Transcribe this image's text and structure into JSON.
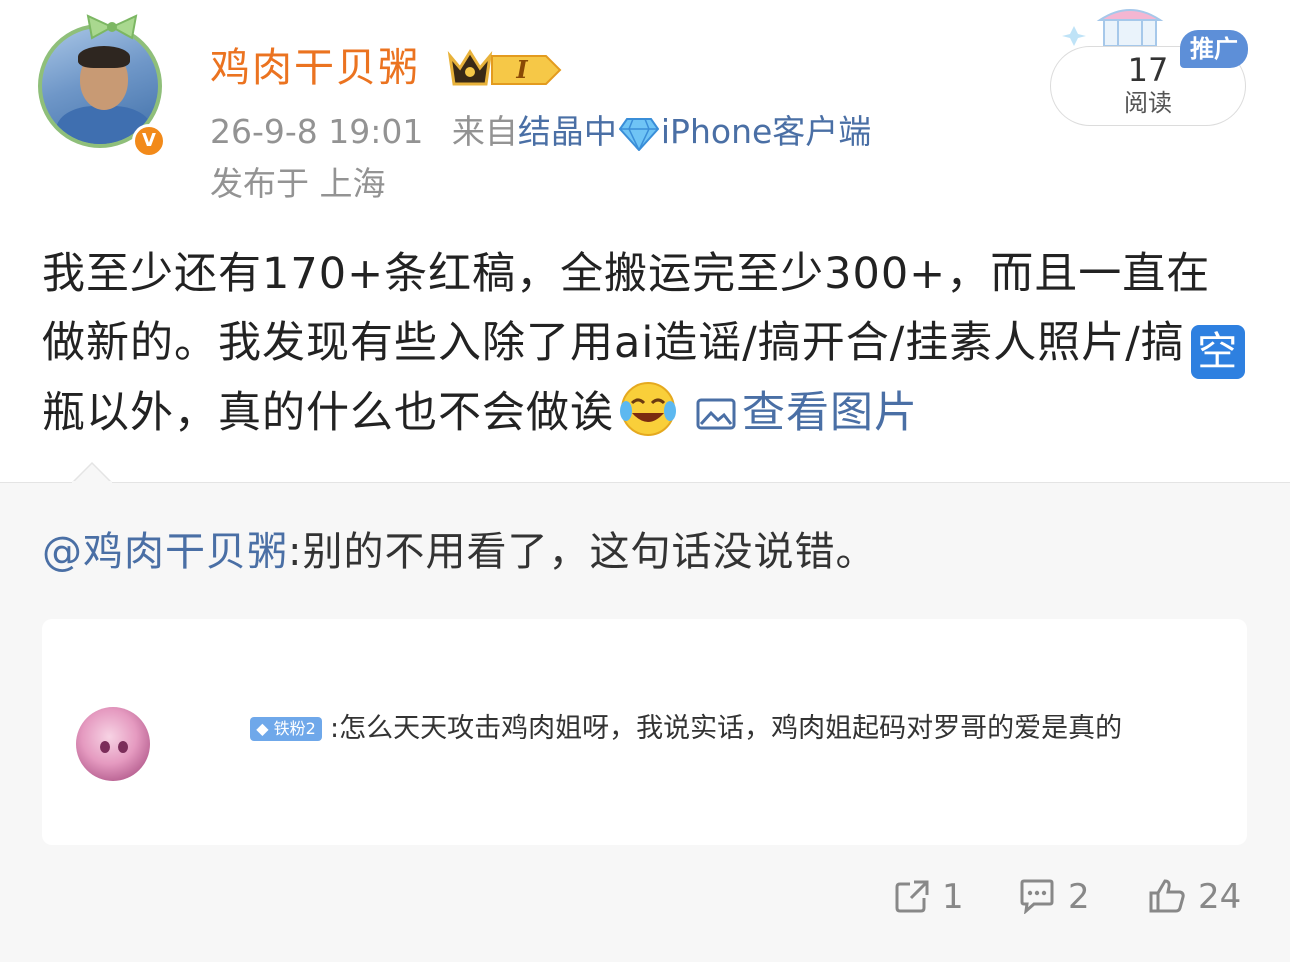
{
  "header": {
    "username": "鸡肉干贝粥",
    "level_badge": "I",
    "timestamp": "26-9-8 19:01",
    "source_prefix": "来自",
    "source_link": "结晶中",
    "source_client": "iPhone客户端",
    "location": "发布于 上海",
    "verified_badge": "V"
  },
  "read_box": {
    "count": "17",
    "label": "阅读",
    "promo_label": "推广"
  },
  "post": {
    "text_part1": "我至少还有170+条红稿，全搬运完至少300+，而且一直在做新的。我发现有些入除了用ai造谣/搞开合/挂素人照片/搞",
    "emoji_kong": "空",
    "text_part2": "瓶以外，真的什么也不会做诶",
    "view_pictures": "查看图片"
  },
  "repost": {
    "mention": "@鸡肉干贝粥",
    "text": ":别的不用看了，这句话没说错。",
    "comment": {
      "fan_badge": "铁粉2",
      "text": ":怎么天天攻击鸡肉姐呀，我说实话，鸡肉姐起码对罗哥的爱是真的"
    }
  },
  "actions": {
    "share_count": "1",
    "comment_count": "2",
    "like_count": "24"
  },
  "colors": {
    "username": "#eb7320",
    "link": "#4a6fa5",
    "meta": "#939393",
    "repost_bg": "#f7f7f7"
  }
}
